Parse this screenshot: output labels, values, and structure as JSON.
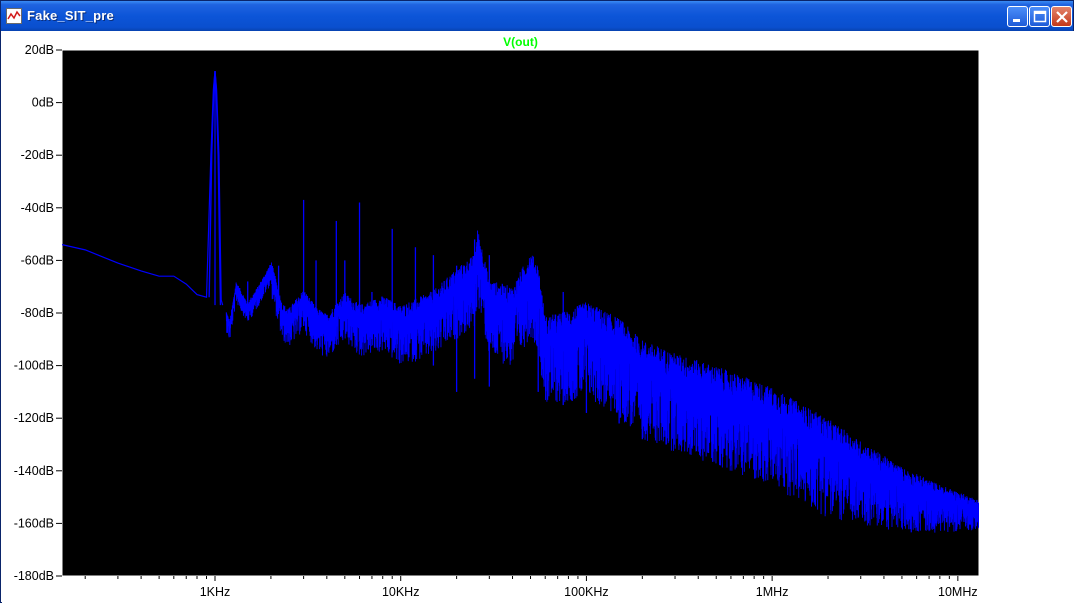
{
  "window": {
    "title": "Fake_SIT_pre",
    "icon": "waveform-icon",
    "controls": [
      "minimize-icon",
      "maximize-icon",
      "close-icon"
    ]
  },
  "colors": {
    "plot_background": "#000000",
    "axis": "#ffffff",
    "tick_labels": "#000000",
    "trace": "#0000ff",
    "trace_label": "#00ff00"
  },
  "chart_data": {
    "type": "line",
    "title": "",
    "trace_label": "V(out)",
    "xscale": "log",
    "xlim": [
      150,
      13000000
    ],
    "ylim": [
      -180,
      20
    ],
    "yticks": [
      20,
      0,
      -20,
      -40,
      -60,
      -80,
      -100,
      -120,
      -140,
      -160,
      -180
    ],
    "ytick_labels": [
      "20dB",
      "0dB",
      "-20dB",
      "-40dB",
      "-60dB",
      "-80dB",
      "-100dB",
      "-120dB",
      "-140dB",
      "-160dB",
      "-180dB"
    ],
    "xticks": [
      1000,
      10000,
      100000,
      1000000,
      10000000
    ],
    "xtick_labels": [
      "1KHz",
      "10KHz",
      "100KHz",
      "1MHz",
      "10MHz"
    ],
    "grid": false,
    "series": [
      {
        "name": "V(out)",
        "x": [
          150,
          200,
          300,
          400,
          500,
          600,
          700,
          800,
          900,
          950,
          980,
          1000,
          1020,
          1050,
          1080,
          1100,
          1200,
          1300,
          1500,
          1700,
          2000,
          2300,
          2500,
          3000,
          3500,
          4000,
          5000,
          6000,
          8000,
          10000,
          15000,
          20000,
          25000,
          26000,
          30000,
          40000,
          50000,
          55000,
          60000,
          80000,
          100000,
          150000,
          200000,
          300000,
          500000,
          1000000,
          2000000,
          3000000,
          5000000,
          8000000,
          13000000
        ],
        "y": [
          -54,
          -56,
          -61,
          -64,
          -66,
          -66,
          -69,
          -73,
          -74,
          -20,
          5,
          12,
          5,
          -20,
          -75,
          -77,
          -85,
          -70,
          -78,
          -72,
          -63,
          -80,
          -82,
          -75,
          -82,
          -85,
          -77,
          -82,
          -79,
          -83,
          -78,
          -70,
          -65,
          -55,
          -75,
          -78,
          -65,
          -70,
          -90,
          -88,
          -85,
          -92,
          -100,
          -105,
          -110,
          -118,
          -130,
          -137,
          -145,
          -150,
          -154
        ],
        "spikes": [
          {
            "x": 1000,
            "top": 12,
            "bottom": -77
          },
          {
            "x": 1500,
            "top": -68,
            "bottom": -80
          },
          {
            "x": 2200,
            "top": -62,
            "bottom": -78
          },
          {
            "x": 3000,
            "top": -37,
            "bottom": -82
          },
          {
            "x": 3500,
            "top": -60,
            "bottom": -80
          },
          {
            "x": 4500,
            "top": -45,
            "bottom": -82
          },
          {
            "x": 5000,
            "top": -60,
            "bottom": -80
          },
          {
            "x": 6000,
            "top": -38,
            "bottom": -88
          },
          {
            "x": 7000,
            "top": -72,
            "bottom": -85
          },
          {
            "x": 9000,
            "top": -48,
            "bottom": -95
          },
          {
            "x": 12000,
            "top": -55,
            "bottom": -96
          },
          {
            "x": 15000,
            "top": -58,
            "bottom": -100
          },
          {
            "x": 20000,
            "top": -62,
            "bottom": -110
          },
          {
            "x": 25000,
            "top": -52,
            "bottom": -105
          },
          {
            "x": 30000,
            "top": -58,
            "bottom": -108
          },
          {
            "x": 55000,
            "top": -68,
            "bottom": -110
          },
          {
            "x": 75000,
            "top": -72,
            "bottom": -115
          },
          {
            "x": 100000,
            "top": -80,
            "bottom": -118
          },
          {
            "x": 150000,
            "top": -90,
            "bottom": -122
          },
          {
            "x": 200000,
            "top": -95,
            "bottom": -128
          }
        ]
      }
    ]
  }
}
